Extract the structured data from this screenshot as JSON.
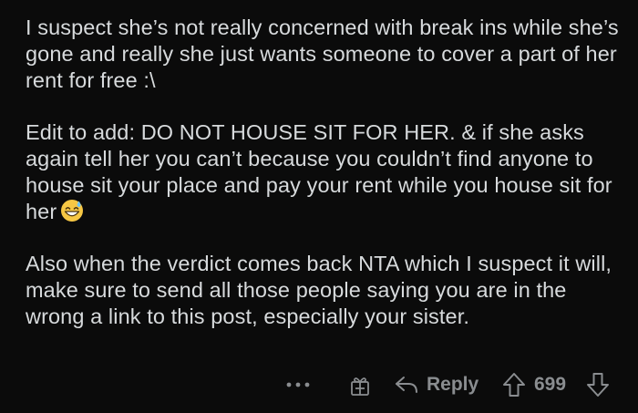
{
  "comment": {
    "paragraph_1": "I suspect she’s not really concerned with break ins while she’s gone and really she just wants someone to cover a part of her rent for free :\\",
    "paragraph_2": "Edit to add: DO NOT HOUSE SIT FOR HER. & if she asks again tell her you can’t because you couldn’t find anyone to house sit your place and pay your rent while you house sit for her",
    "paragraph_2_emoji": "grinning-sweat-emoji",
    "paragraph_3": "Also when the verdict comes back NTA which I suspect it will, make sure to send all those people saying you are in the wrong a link to this post, especially your sister."
  },
  "actions": {
    "more_icon": "ellipsis-icon",
    "award_icon": "gift-icon",
    "reply_icon": "reply-arrow-icon",
    "reply_label": "Reply",
    "upvote_icon": "upvote-arrow-icon",
    "score": "699",
    "downvote_icon": "downvote-arrow-icon"
  },
  "colors": {
    "background": "#0b0b0b",
    "text": "#d7dadc",
    "muted": "#8a8d90"
  }
}
